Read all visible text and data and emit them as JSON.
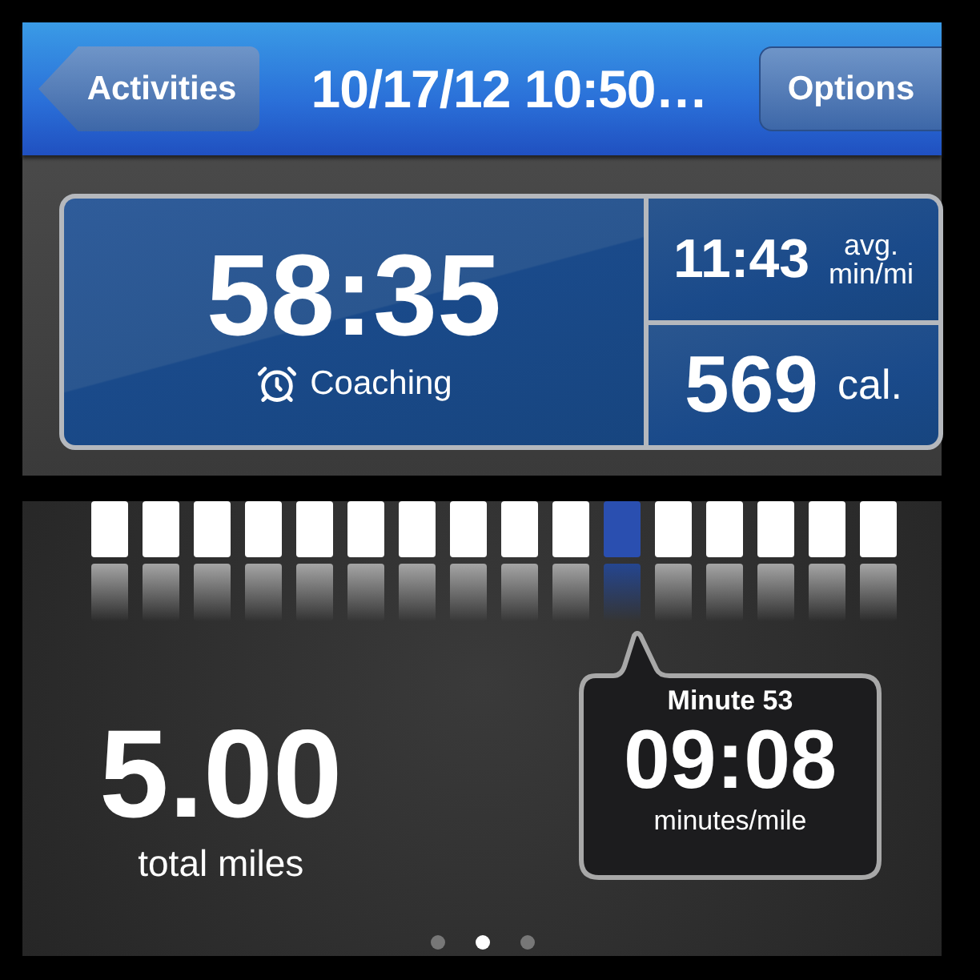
{
  "nav_bar": {
    "back_button": "Activities",
    "title": "10/17/12 10:50…",
    "options_button": "Options"
  },
  "summary": {
    "duration": "58:35",
    "coaching_label": "Coaching",
    "pace": "11:43",
    "pace_unit_top": "avg.",
    "pace_unit_bottom": "min/mi",
    "calories": "569",
    "calories_unit": "cal."
  },
  "splits": [
    {
      "selected": false
    },
    {
      "selected": false
    },
    {
      "selected": false
    },
    {
      "selected": false
    },
    {
      "selected": false
    },
    {
      "selected": false
    },
    {
      "selected": false
    },
    {
      "selected": false
    },
    {
      "selected": false
    },
    {
      "selected": false
    },
    {
      "selected": true
    },
    {
      "selected": false
    },
    {
      "selected": false
    },
    {
      "selected": false
    },
    {
      "selected": false
    },
    {
      "selected": false
    }
  ],
  "distance": {
    "value": "5.00",
    "label": "total miles"
  },
  "tooltip": {
    "title": "Minute 53",
    "pace": "09:08",
    "unit": "minutes/mile"
  },
  "pages": [
    {
      "selected": false
    },
    {
      "selected": true
    },
    {
      "selected": false
    }
  ]
}
